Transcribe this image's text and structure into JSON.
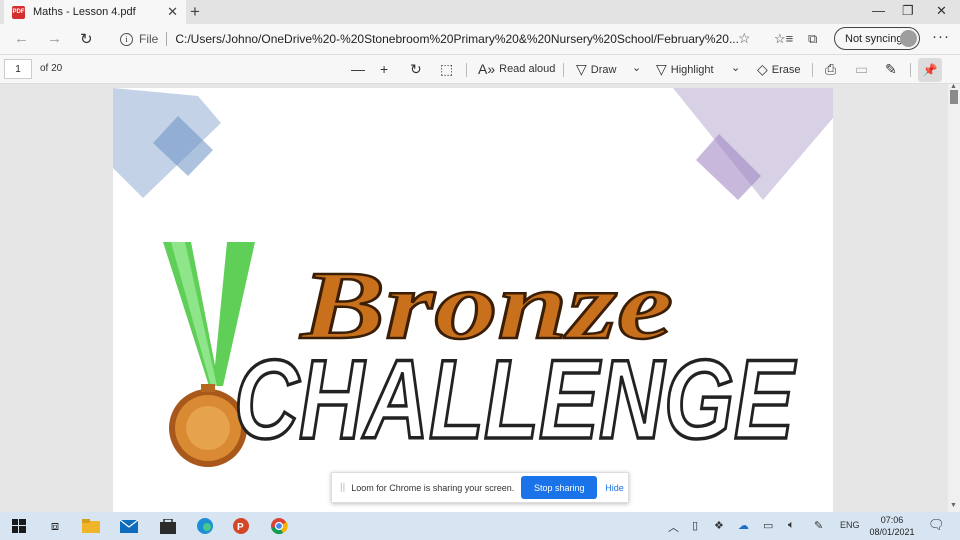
{
  "tab": {
    "title": "Maths - Lesson 4.pdf",
    "pdf_icon_text": "PDF"
  },
  "address": {
    "file_label": "File",
    "url": "C:/Users/Johno/OneDrive%20-%20Stonebroom%20Primary%20&%20Nursery%20School/February%20..."
  },
  "sync": {
    "label": "Not syncing"
  },
  "pdf_toolbar": {
    "page_number": "1",
    "page_count": "of 20",
    "read_aloud": "Read aloud",
    "draw": "Draw",
    "highlight": "Highlight",
    "erase": "Erase"
  },
  "document": {
    "word_top": "Bronze",
    "word_bottom": "CHALLENGE",
    "colors": {
      "bronze": "#c8701b",
      "ribbon": "#6fd36a",
      "medal": "#c87d2a"
    }
  },
  "loom": {
    "message": "Loom for Chrome is sharing your screen.",
    "stop": "Stop sharing",
    "hide": "Hide"
  },
  "taskbar": {
    "language": "ENG",
    "time": "07:06",
    "date": "08/01/2021"
  },
  "icons": [
    "pdf-icon",
    "back-icon",
    "forward-icon",
    "refresh-icon",
    "info-icon",
    "star-icon",
    "favorites-icon",
    "collections-icon",
    "more-icon",
    "zoom-out-icon",
    "zoom-in-icon",
    "rotate-icon",
    "fit-page-icon",
    "read-aloud-icon",
    "draw-icon",
    "highlight-icon",
    "erase-icon",
    "print-icon",
    "save-icon",
    "save-as-icon",
    "pin-icon",
    "windows-start-icon",
    "task-view-icon",
    "file-explorer-icon",
    "mail-icon",
    "store-icon",
    "edge-icon",
    "powerpoint-icon",
    "chrome-icon"
  ]
}
